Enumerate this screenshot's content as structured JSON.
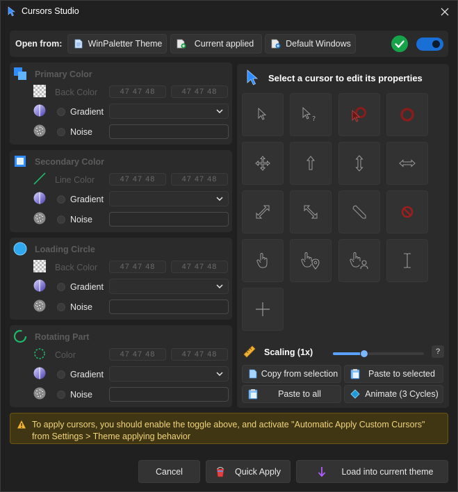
{
  "window": {
    "title": "Cursors Studio"
  },
  "open_from": {
    "label": "Open from:",
    "buttons": [
      {
        "label": "WinPaletter Theme",
        "icon": "document-icon"
      },
      {
        "label": "Current applied",
        "icon": "document-add-icon"
      },
      {
        "label": "Default Windows",
        "icon": "document-add-icon"
      }
    ],
    "toggle_on": true,
    "status_color": "#16a34a"
  },
  "sections": [
    {
      "title": "Primary Color",
      "color_label": "Back Color",
      "color1": "47 47 48",
      "color2": "47 47 48",
      "gradient_label": "Gradient",
      "noise_label": "Noise"
    },
    {
      "title": "Secondary Color",
      "color_label": "Line Color",
      "color1": "47 47 48",
      "color2": "47 47 48",
      "gradient_label": "Gradient",
      "noise_label": "Noise"
    },
    {
      "title": "Loading Circle",
      "color_label": "Back Color",
      "color1": "47 47 48",
      "color2": "47 47 48",
      "gradient_label": "Gradient",
      "noise_label": "Noise"
    },
    {
      "title": "Rotating Part",
      "color_label": "Color",
      "color1": "47 47 48",
      "color2": "47 47 48",
      "gradient_label": "Gradient",
      "noise_label": "Noise"
    }
  ],
  "cursor_panel": {
    "title": "Select a cursor to edit its properties",
    "cursors": [
      "arrow-cursor-icon",
      "help-cursor-icon",
      "app-starting-cursor-icon",
      "busy-cursor-icon",
      "move-cursor-icon",
      "up-arrow-cursor-icon",
      "ns-resize-cursor-icon",
      "ew-resize-cursor-icon",
      "nesw-resize-cursor-icon",
      "nwse-resize-cursor-icon",
      "pen-cursor-icon",
      "unavailable-cursor-icon",
      "hand-cursor-icon",
      "pin-cursor-icon",
      "person-cursor-icon",
      "text-cursor-icon",
      "cross-cursor-icon"
    ],
    "scaling_label": "Scaling (1x)",
    "scaling_value": 0.33,
    "help_label": "?",
    "actions": {
      "copy": "Copy from selection",
      "paste_selected": "Paste to selected",
      "paste_all": "Paste to all",
      "animate": "Animate (3 Cycles)"
    }
  },
  "info": {
    "text": "To apply cursors, you should enable the toggle above, and activate \"Automatic Apply Custom Cursors\" from Settings > Theme applying behavior"
  },
  "footer": {
    "cancel": "Cancel",
    "quick_apply": "Quick Apply",
    "load": "Load into current theme"
  }
}
